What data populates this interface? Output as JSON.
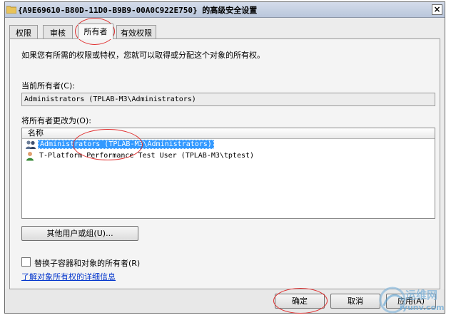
{
  "window": {
    "title": "{A9E69610-B80D-11D0-B9B9-00A0C922E750} 的高级安全设置",
    "close_label": "×"
  },
  "tabs": [
    {
      "label": "权限"
    },
    {
      "label": "审核"
    },
    {
      "label": "所有者",
      "active": true
    },
    {
      "label": "有效权限"
    }
  ],
  "owner_tab": {
    "description": "如果您有所需的权限或特权，您就可以取得或分配这个对象的所有权。",
    "current_owner_label": "当前所有者(C):",
    "current_owner_value": "Administrators (TPLAB-M3\\Administrators)",
    "change_owner_label": "将所有者更改为(O):",
    "list_header": "名称",
    "list_items": [
      {
        "text": "Administrators (TPLAB-M3\\Administrators)",
        "icon": "group-users-icon",
        "selected": true
      },
      {
        "text": "T-Platform Performance Test User (TPLAB-M3\\tptest)",
        "icon": "user-icon",
        "selected": false
      }
    ],
    "other_users_button": "其他用户或组(U)...",
    "replace_checkbox_label": "替换子容器和对象的所有者(R)",
    "replace_checked": false,
    "learn_more_link": "了解对象所有权的详细信息"
  },
  "buttons": {
    "ok": "确定",
    "cancel": "取消",
    "apply": "应用(A)"
  },
  "watermark": {
    "text": "运维网",
    "url": "iyunv.com"
  },
  "colors": {
    "selection": "#3399ff",
    "annotation": "#e03030",
    "link": "#0033cc"
  }
}
